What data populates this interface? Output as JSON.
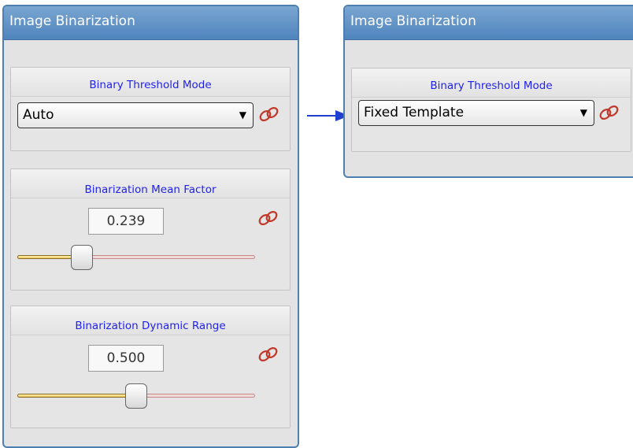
{
  "left_panel": {
    "title": "Image Binarization",
    "threshold_mode": {
      "label": "Binary Threshold Mode",
      "value": "Auto"
    },
    "mean_factor": {
      "label": "Binarization Mean Factor",
      "value": "0.239",
      "slider_fraction": 0.27
    },
    "dynamic_range": {
      "label": "Binarization Dynamic Range",
      "value": "0.500",
      "slider_fraction": 0.5
    }
  },
  "right_panel": {
    "title": "Image Binarization",
    "threshold_mode": {
      "label": "Binary Threshold Mode",
      "value": "Fixed Template"
    }
  },
  "colors": {
    "accent": "#4f84bd",
    "label_blue": "#1f1ff0",
    "link_red": "#c0392b",
    "arrow_blue": "#1f3fd0"
  },
  "icons": {
    "dropdown": "chevron-down-icon",
    "link": "chain-link-icon",
    "arrow": "arrow-right-icon"
  }
}
